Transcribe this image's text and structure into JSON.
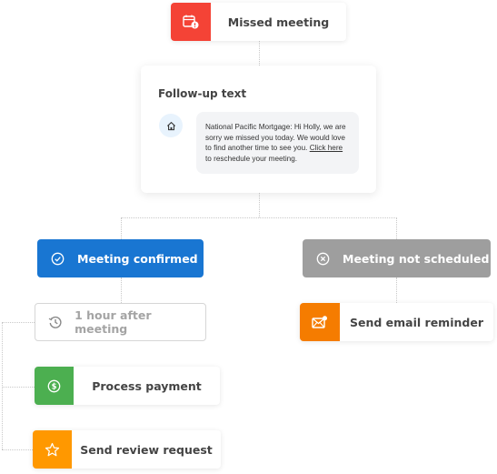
{
  "trigger": {
    "label": "Missed meeting",
    "icon": "calendar-alert-icon",
    "color": "#f44336"
  },
  "followup": {
    "title": "Follow-up text",
    "avatar_icon": "home-icon",
    "message_prefix": "National Pacific Mortgage: Hi Holly, we are sorry we missed you today. We would love to find another time to see you. ",
    "message_link": "Click here",
    "message_suffix": " to reschedule your meeting."
  },
  "branches": {
    "confirmed": {
      "label": "Meeting confirmed",
      "icon": "check-circle-icon",
      "color": "#1976d2"
    },
    "not_scheduled": {
      "label": "Meeting not scheduled",
      "icon": "x-circle-icon",
      "color": "#9e9e9e"
    }
  },
  "delay": {
    "label": "1 hour after meeting",
    "icon": "history-icon"
  },
  "actions": {
    "payment": {
      "label": "Process payment",
      "icon": "dollar-circle-icon",
      "color": "#4caf50"
    },
    "review": {
      "label": "Send review request",
      "icon": "star-icon",
      "color": "#ff9800"
    },
    "email": {
      "label": "Send email reminder",
      "icon": "email-icon",
      "color": "#f57c00"
    }
  }
}
